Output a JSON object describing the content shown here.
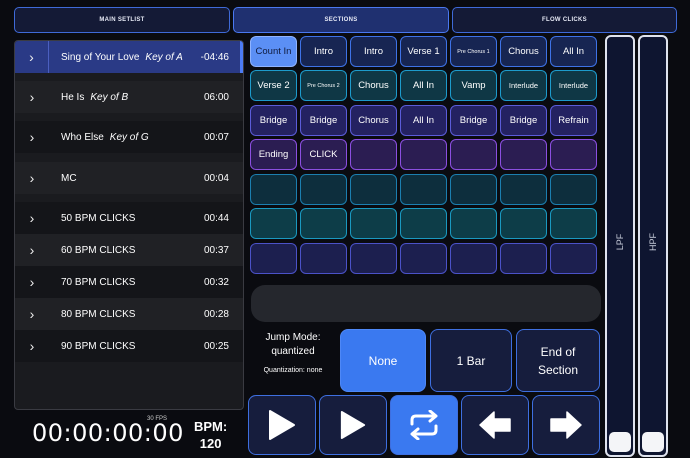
{
  "tabs": [
    {
      "label": "MAIN SETLIST"
    },
    {
      "label": "SECTIONS"
    },
    {
      "label": "FLOW CLICKS"
    }
  ],
  "setlist": [
    {
      "title": "Sing of Your Love",
      "key": "Key of A",
      "time": "-04:46"
    },
    {
      "title": "He Is",
      "key": "Key of B",
      "time": "06:00"
    },
    {
      "title": "Who Else",
      "key": "Key of G",
      "time": "00:07"
    },
    {
      "title": "MC",
      "key": "",
      "time": "00:04"
    },
    {
      "title": "50 BPM CLICKS",
      "key": "",
      "time": "00:44"
    },
    {
      "title": "60 BPM CLICKS",
      "key": "",
      "time": "00:37"
    },
    {
      "title": "70 BPM CLICKS",
      "key": "",
      "time": "00:32"
    },
    {
      "title": "80 BPM CLICKS",
      "key": "",
      "time": "00:28"
    },
    {
      "title": "90 BPM CLICKS",
      "key": "",
      "time": "00:25"
    }
  ],
  "sections": {
    "row1": [
      "Count In",
      "Intro",
      "Intro",
      "Verse 1",
      "Pre Chorus 1",
      "Chorus",
      "All In"
    ],
    "row2": [
      "Verse 2",
      "Pre Chorus 2",
      "Chorus",
      "All In",
      "Vamp",
      "Interlude",
      "Interlude"
    ],
    "row3": [
      "Bridge",
      "Bridge",
      "Chorus",
      "All In",
      "Bridge",
      "Bridge",
      "Refrain"
    ],
    "row4": [
      "Ending",
      "CLICK",
      "",
      "",
      "",
      "",
      ""
    ]
  },
  "transport": {
    "timecode": "00:00:00:00",
    "fps": "30 FPS",
    "bpm_label": "BPM:",
    "bpm_value": "120"
  },
  "jump": {
    "mode_label": "Jump Mode:",
    "mode_value": "quantized",
    "quantization": "Quantization: none",
    "options": [
      "None",
      "1 Bar",
      "End of Section"
    ],
    "selected": "None"
  },
  "faders": [
    {
      "label": "LPF"
    },
    {
      "label": "HPF"
    }
  ],
  "icons": {
    "row": "chevron-right-icon",
    "play": "play-icon",
    "play2": "play-icon",
    "loop": "loop-icon",
    "back": "arrow-left-icon",
    "forward": "arrow-right-icon"
  },
  "colors": {
    "accent": "#3a79f0",
    "active_row": "#2a3a86"
  }
}
